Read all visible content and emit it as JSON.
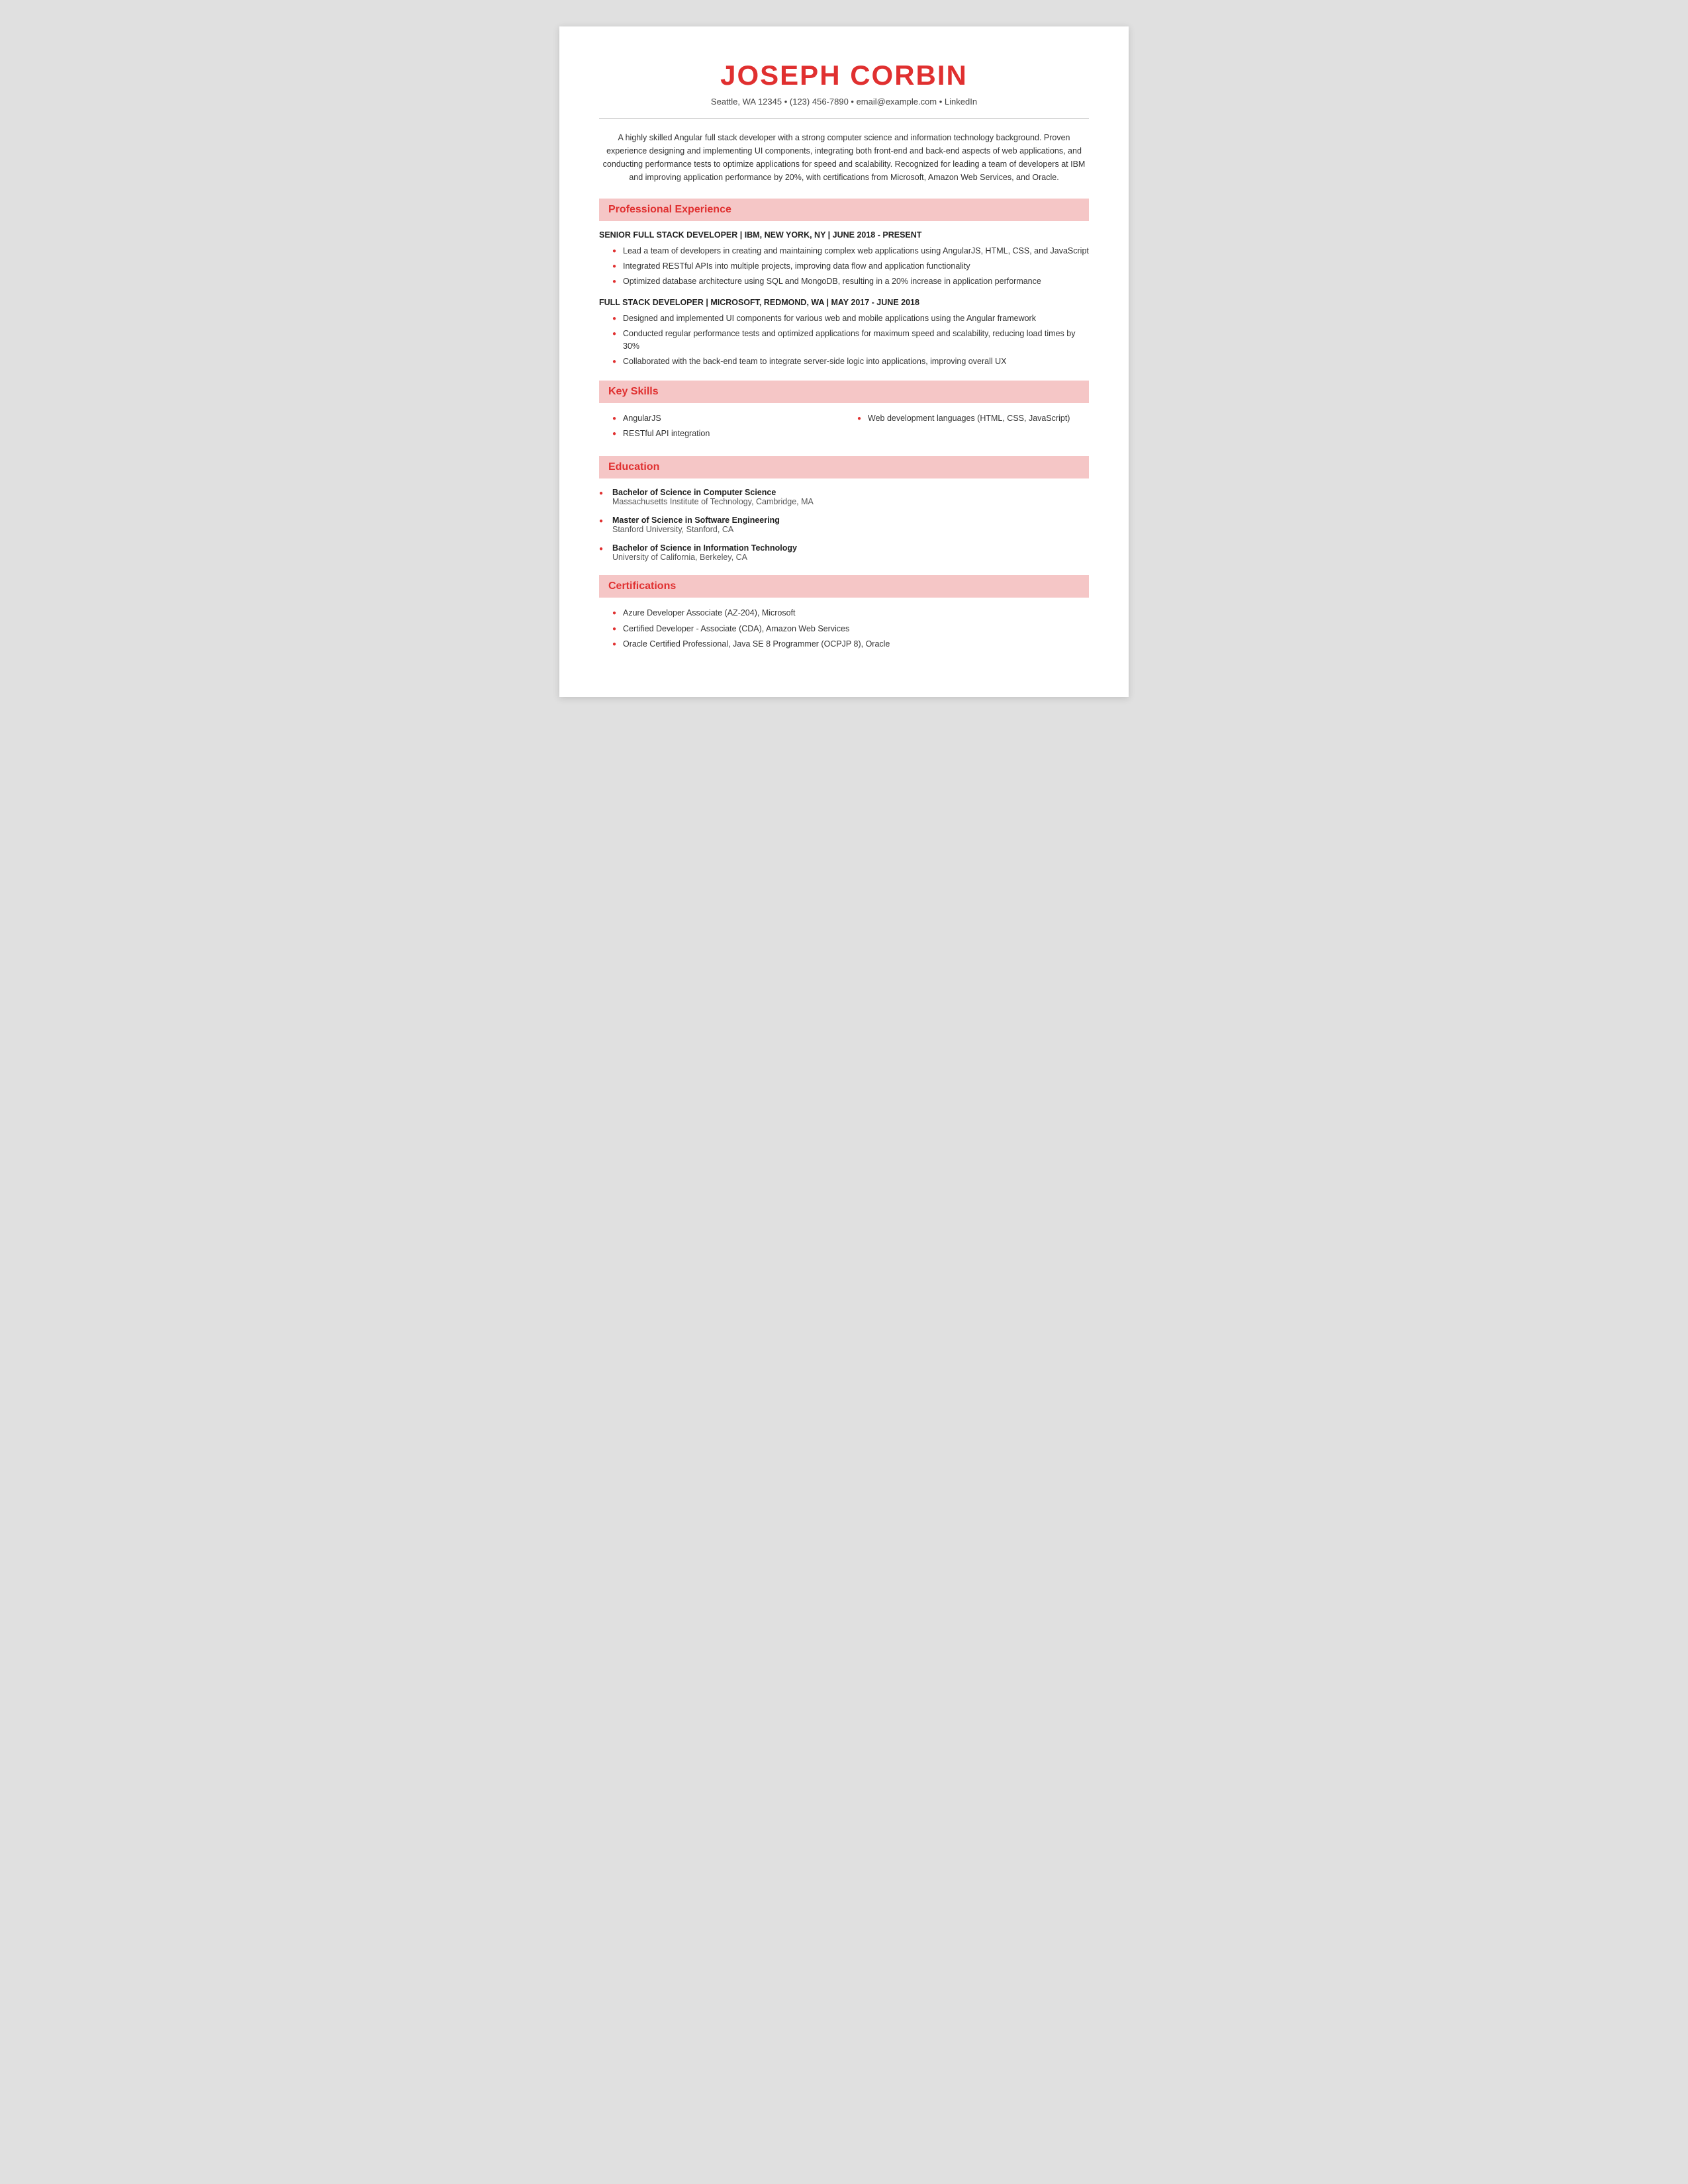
{
  "header": {
    "name": "JOSEPH CORBIN",
    "contact": "Seattle, WA 12345 • (123) 456-7890 • email@example.com • LinkedIn"
  },
  "summary": "A highly skilled Angular full stack developer with a strong computer science and information technology background. Proven experience designing and implementing UI components, integrating both front-end and back-end aspects of web applications, and conducting performance tests to optimize applications for speed and scalability. Recognized for leading a team of developers at IBM and improving application performance by 20%, with certifications from Microsoft, Amazon Web Services, and Oracle.",
  "sections": {
    "professional_experience": {
      "title": "Professional Experience",
      "jobs": [
        {
          "title_line": "SENIOR FULL STACK DEVELOPER | IBM, NEW YORK, NY | JUNE 2018 - PRESENT",
          "bullets": [
            "Lead a team of developers in creating and maintaining complex web applications using AngularJS, HTML, CSS, and JavaScript",
            "Integrated RESTful APIs into multiple projects, improving data flow and application functionality",
            "Optimized database architecture using SQL and MongoDB, resulting in a 20% increase in application performance"
          ]
        },
        {
          "title_line": "FULL STACK DEVELOPER | MICROSOFT, REDMOND, WA | MAY 2017 - JUNE 2018",
          "bullets": [
            "Designed and implemented UI components for various web and mobile applications using the Angular framework",
            "Conducted regular performance tests and optimized applications for maximum speed and scalability, reducing load times by 30%",
            "Collaborated with the back-end team to integrate server-side logic into applications, improving overall UX"
          ]
        }
      ]
    },
    "key_skills": {
      "title": "Key Skills",
      "col1": [
        "AngularJS",
        "RESTful API integration"
      ],
      "col2": [
        "Web development languages (HTML, CSS, JavaScript)"
      ]
    },
    "education": {
      "title": "Education",
      "items": [
        {
          "degree": "Bachelor of Science in Computer Science",
          "school": "Massachusetts Institute of Technology, Cambridge, MA"
        },
        {
          "degree": "Master of Science in Software Engineering",
          "school": "Stanford University, Stanford, CA"
        },
        {
          "degree": "Bachelor of Science in Information Technology",
          "school": "University of California, Berkeley, CA"
        }
      ]
    },
    "certifications": {
      "title": "Certifications",
      "items": [
        "Azure Developer Associate (AZ-204), Microsoft",
        "Certified Developer - Associate (CDA), Amazon Web Services",
        "Oracle Certified Professional, Java SE 8 Programmer (OCPJP 8), Oracle"
      ]
    }
  }
}
